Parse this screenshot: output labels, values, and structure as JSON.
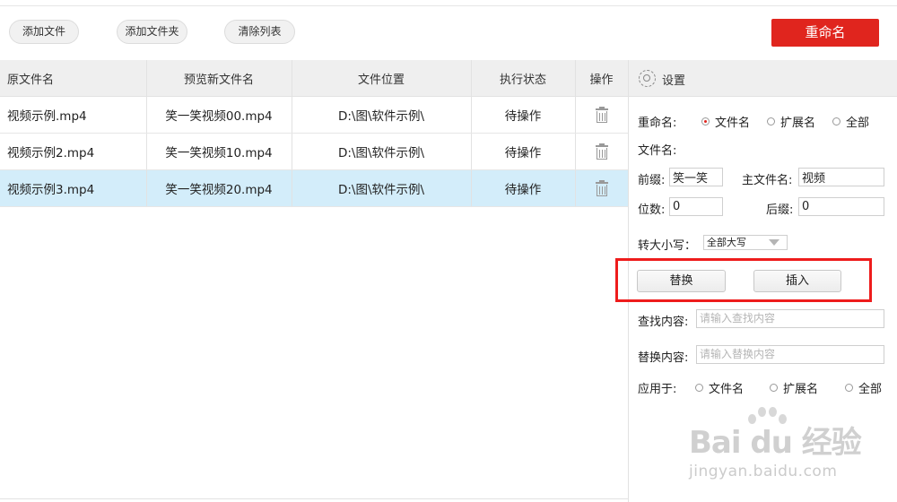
{
  "toolbar": {
    "add_file": "添加文件",
    "add_folder": "添加文件夹",
    "clear_list": "清除列表",
    "rename": "重命名"
  },
  "table": {
    "headers": [
      "原文件名",
      "预览新文件名",
      "文件位置",
      "执行状态",
      "操作"
    ],
    "rows": [
      {
        "original": "视频示例.mp4",
        "preview": "笑一笑视频00.mp4",
        "location": "D:\\图\\软件示例\\",
        "status": "待操作",
        "selected": false
      },
      {
        "original": "视频示例2.mp4",
        "preview": "笑一笑视频10.mp4",
        "location": "D:\\图\\软件示例\\",
        "status": "待操作",
        "selected": false
      },
      {
        "original": "视频示例3.mp4",
        "preview": "笑一笑视频20.mp4",
        "location": "D:\\图\\软件示例\\",
        "status": "待操作",
        "selected": true
      }
    ]
  },
  "settings": {
    "title": "设置",
    "rename_label": "重命名:",
    "rename_options": [
      "文件名",
      "扩展名",
      "全部"
    ],
    "rename_selected": "文件名",
    "filename_label": "文件名:",
    "prefix_label": "前缀:",
    "prefix_value": "笑一笑",
    "main_name_label": "主文件名:",
    "main_name_value": "视频",
    "digits_label": "位数:",
    "digits_value": "0",
    "suffix_label": "后缀:",
    "suffix_value": "0",
    "case_label": "转大小写：",
    "case_value": "全部大写",
    "replace_button": "替换",
    "insert_button": "插入",
    "find_label": "查找内容:",
    "find_placeholder": "请输入查找内容",
    "replace_label": "替换内容:",
    "replace_placeholder": "请输入替换内容",
    "apply_label": "应用于:",
    "apply_options": [
      "文件名",
      "扩展名",
      "全部"
    ]
  },
  "watermark": {
    "logo": "Bai du 经验",
    "sub": "jingyan.baidu.com"
  },
  "colors": {
    "accent": "#e0251e",
    "selected_row": "#d3edfa",
    "highlight_box": "#ee1c1c"
  }
}
